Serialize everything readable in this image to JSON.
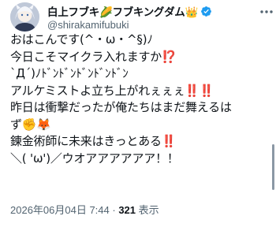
{
  "user": {
    "display_name": "白上フブキ🌽フブキングダム👑",
    "handle": "@shirakamifubuki",
    "avatar_icon": "avatar-image",
    "verified_icon": "verified-badge-icon",
    "verified_color": "#1d9bf0"
  },
  "more_icon": "more-options-icon",
  "tweet": {
    "lines": [
      "おはこんです(^・ω・^§)ﾉ",
      "今日こそマイクラ入れますか⁉️",
      "`Д´)ﾉﾄﾞﾝﾄﾞﾝﾄﾞﾝﾄﾞﾝﾄﾞﾝ",
      "アルケミストよ立ち上がれぇぇぇ‼️‼️",
      "昨日は衝撃だったが俺たちはまだ舞えるは",
      "ず✊🦊",
      "錬金術師に未来はきっとある‼️",
      "＼( 'ω')／ウオアアアアアア！！"
    ]
  },
  "meta": {
    "timestamp": "2026年06月04日 7:44",
    "separator": " · ",
    "views_count": "321",
    "views_label": " 表示"
  },
  "colors": {
    "text": "#0f1419",
    "secondary": "#536471",
    "accent": "#1d9bf0"
  }
}
